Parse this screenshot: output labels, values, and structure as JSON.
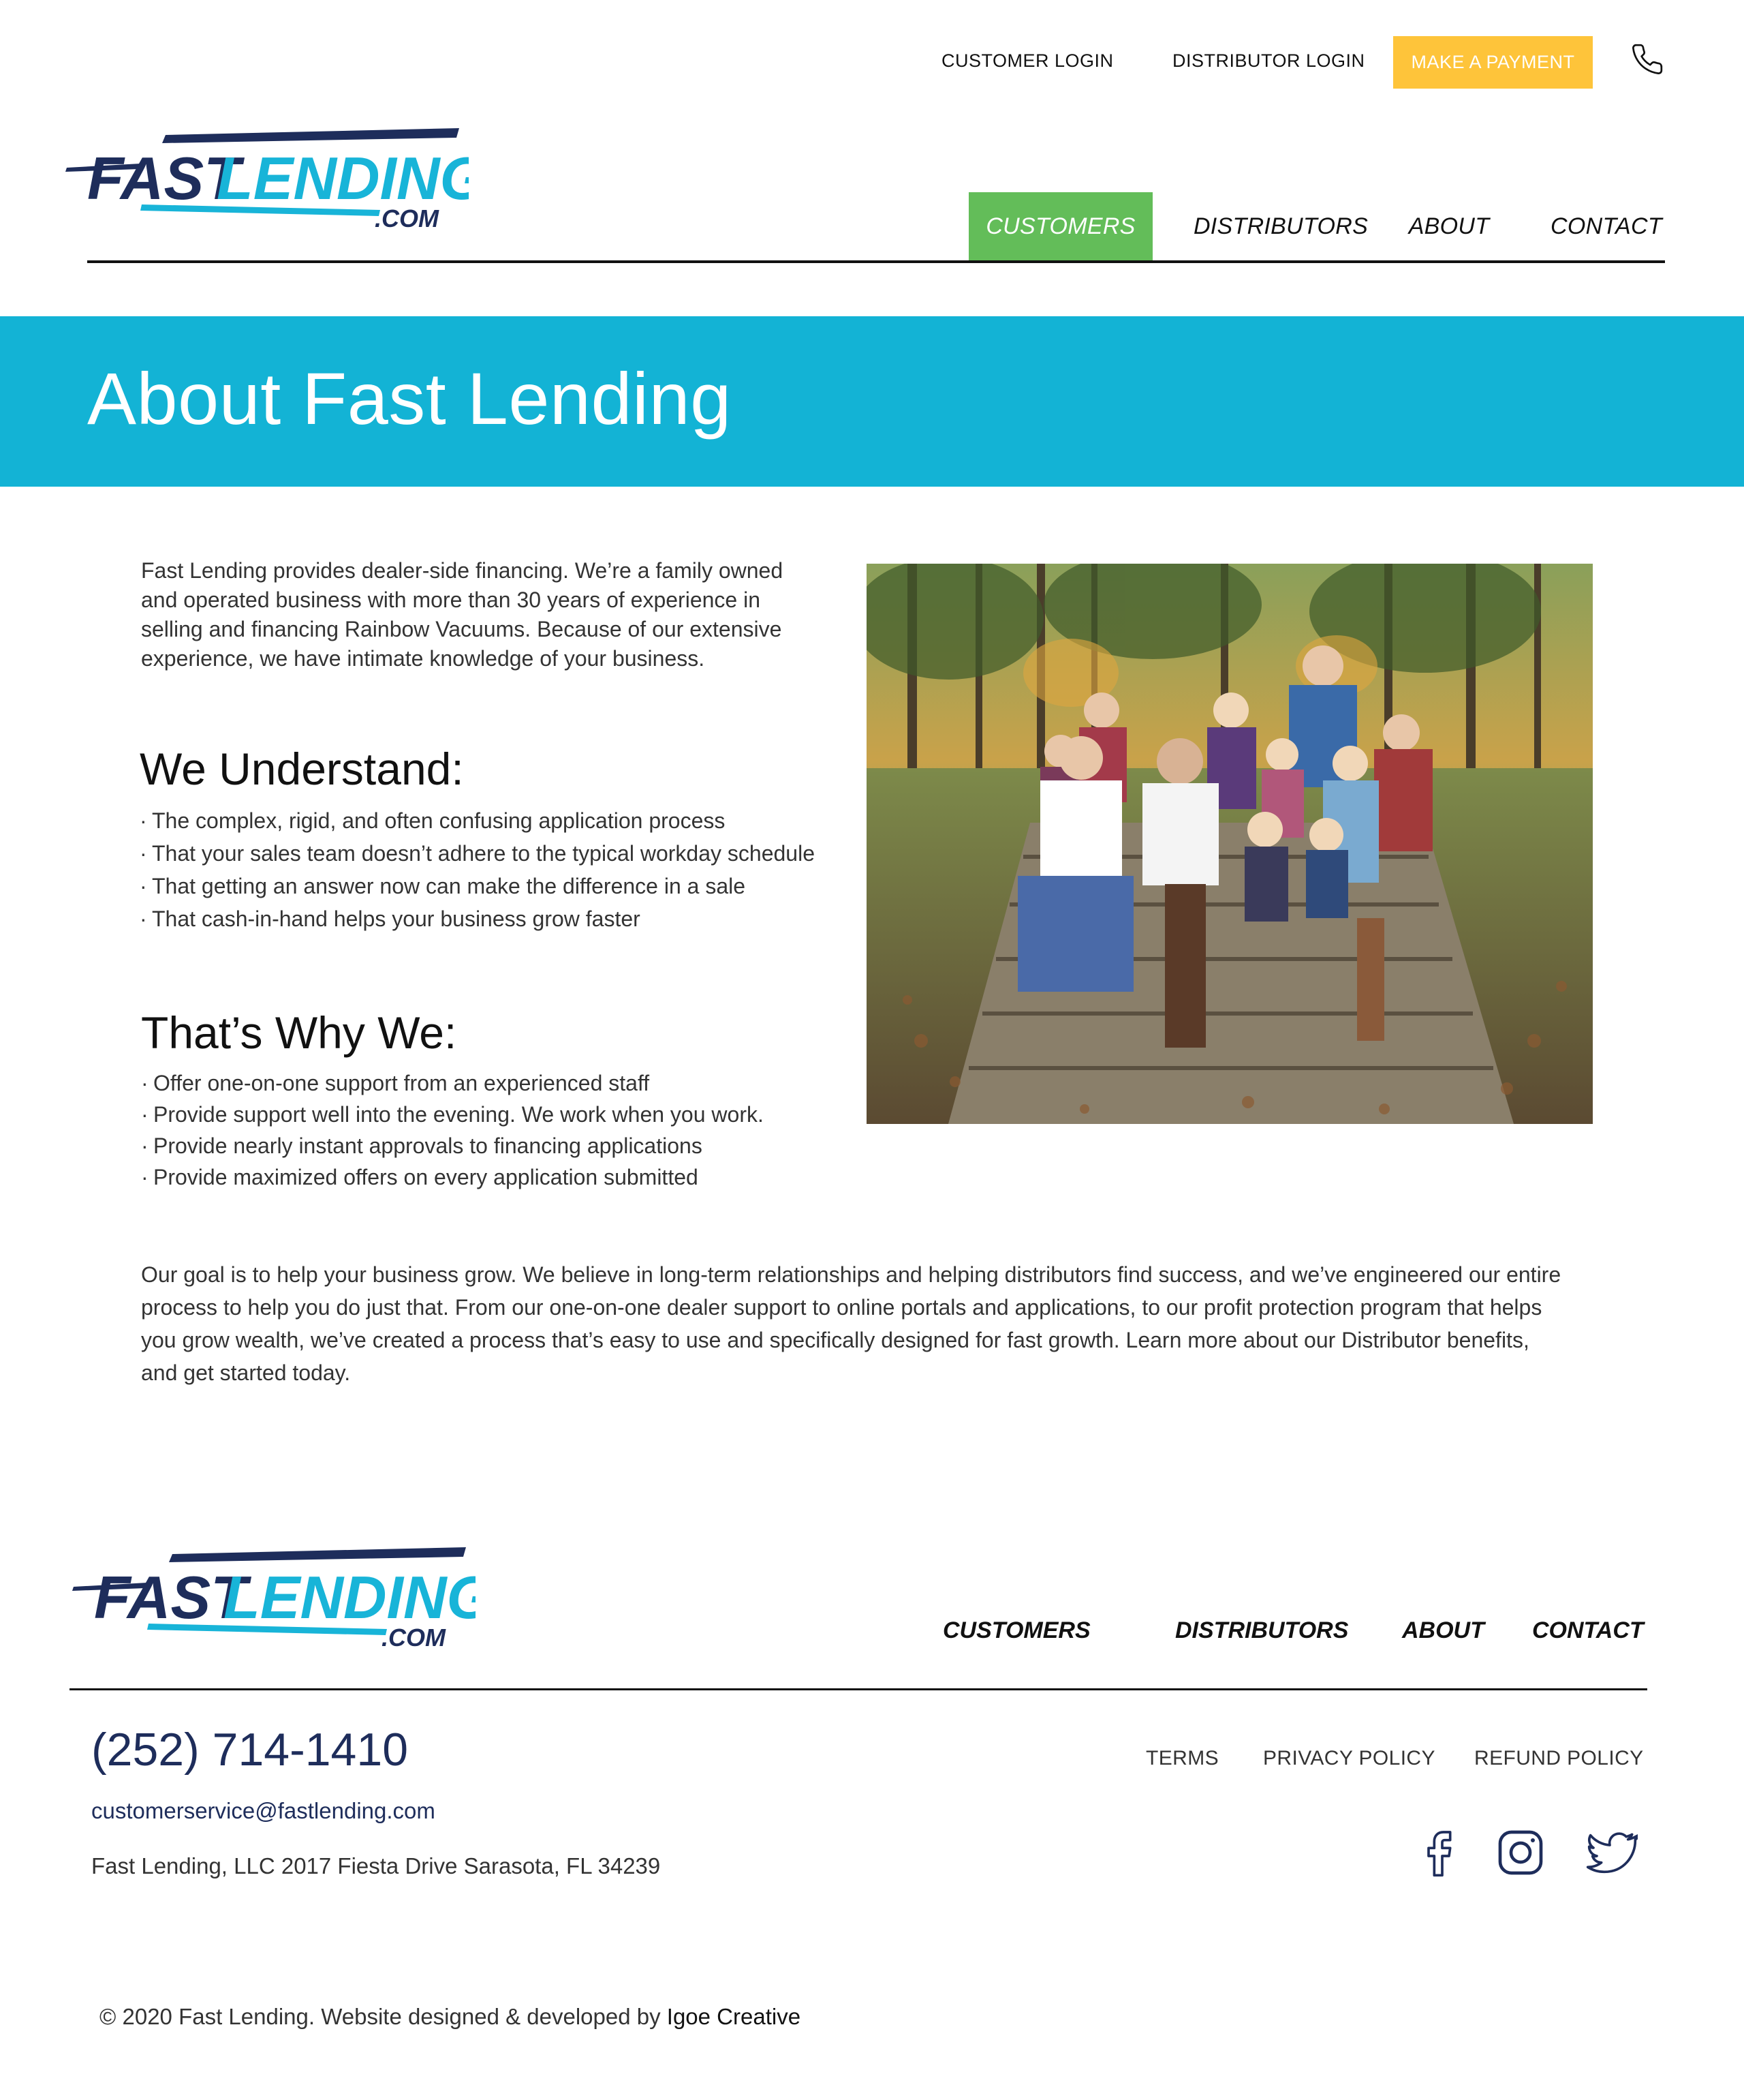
{
  "topbar": {
    "customer_login": "CUSTOMER LOGIN",
    "distributor_login": "DISTRIBUTOR LOGIN",
    "make_payment": "MAKE A PAYMENT",
    "phone_icon": "phone-icon"
  },
  "logo": {
    "word1": "FAST",
    "word2": "LENDING",
    "suffix": ".COM"
  },
  "nav": {
    "customers": "CUSTOMERS",
    "distributors": "DISTRIBUTORS",
    "about": "ABOUT",
    "contact": "CONTACT"
  },
  "hero": {
    "title": "About Fast Lending"
  },
  "intro": "Fast Lending provides dealer-side financing. We’re a family owned and operated business with more than 30 years of experience in selling and financing Rainbow Vacuums. Because of our extensive experience, we have intimate knowledge of your business.",
  "understand": {
    "heading": "We Understand:",
    "items": [
      "The complex, rigid, and often confusing application process",
      "That your sales team doesn’t adhere to the typical workday schedule",
      "That getting an answer now can make the difference in a sale",
      "That cash-in-hand helps your business grow faster"
    ]
  },
  "why": {
    "heading": "That’s Why We:",
    "items": [
      "Offer one-on-one support from an experienced staff",
      "Provide support well into the evening. We work when you work.",
      "Provide nearly instant approvals to financing applications",
      "Provide maximized offers on every application submitted"
    ]
  },
  "goal": "Our goal is to help your business grow. We believe in long-term relationships and helping distributors find success, and we’ve engineered our entire process to help you do just that. From our one-on-one dealer support to online portals and applications, to our profit protection program that helps you grow wealth, we’ve created a process that’s easy to use and specifically designed for fast growth. Learn more about our Distributor benefits, and get started today.",
  "footer": {
    "nav": {
      "customers": "CUSTOMERS",
      "distributors": "DISTRIBUTORS",
      "about": "ABOUT",
      "contact": "CONTACT"
    },
    "phone": "(252) 714-1410",
    "email": "customerservice@fastlending.com",
    "address": "Fast Lending, LLC 2017 Fiesta Drive Sarasota, FL 34239",
    "links": {
      "terms": "TERMS",
      "privacy": "PRIVACY POLICY",
      "refund": "REFUND POLICY"
    },
    "social_icons": [
      "facebook-icon",
      "instagram-icon",
      "twitter-icon"
    ],
    "copyright": "© 2020 Fast Lending. Website designed & developed by",
    "studio": "Igoe Creative"
  },
  "colors": {
    "hero_blue": "#13b3d5",
    "nav_active_green": "#63bd59",
    "payment_yellow": "#fec43a",
    "logo_navy": "#1e2d5b",
    "logo_cyan": "#18b4d8"
  }
}
